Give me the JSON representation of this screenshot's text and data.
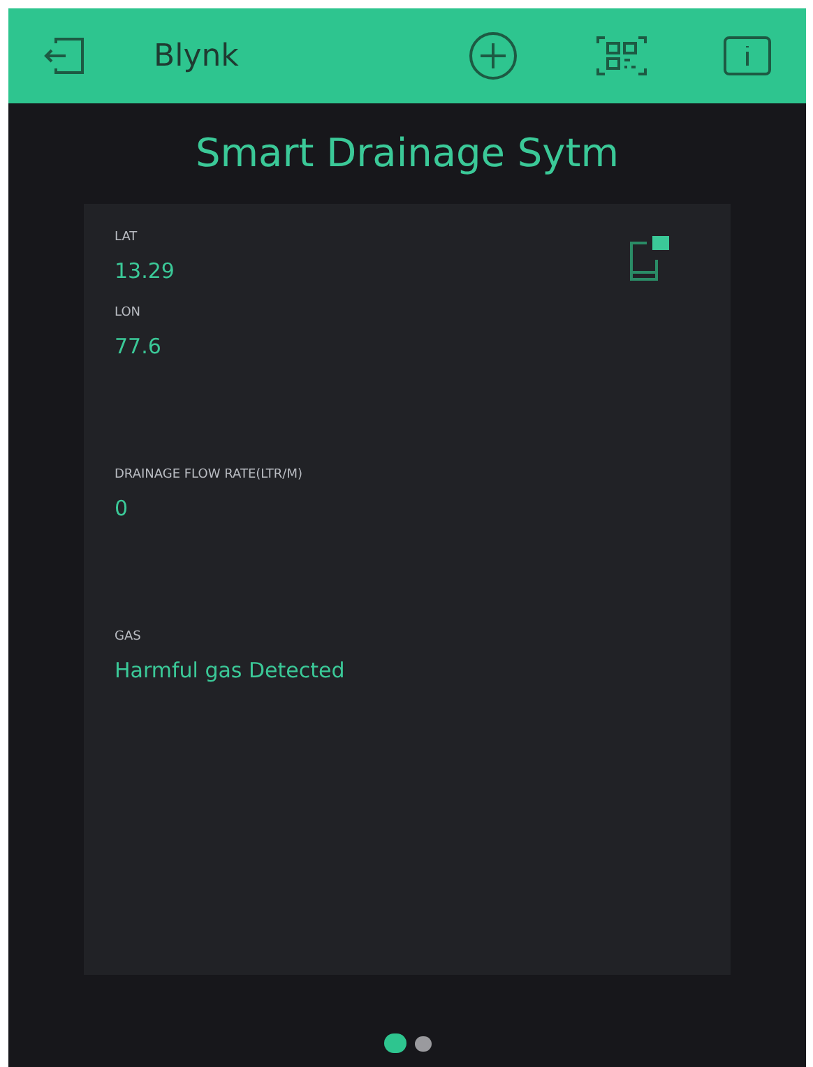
{
  "app_bar": {
    "title": "Blynk"
  },
  "project": {
    "title": "Smart Drainage Sytm"
  },
  "widgets": [
    {
      "label": "LAT",
      "value": "13.29"
    },
    {
      "label": "LON",
      "value": "77.6"
    },
    {
      "label": "DRAINAGE FLOW RATE(LTR/M)",
      "value": "0"
    },
    {
      "label": "GAS",
      "value": "Harmful gas Detected"
    }
  ],
  "pages": [
    {
      "selected": true
    },
    {
      "selected": false
    }
  ]
}
